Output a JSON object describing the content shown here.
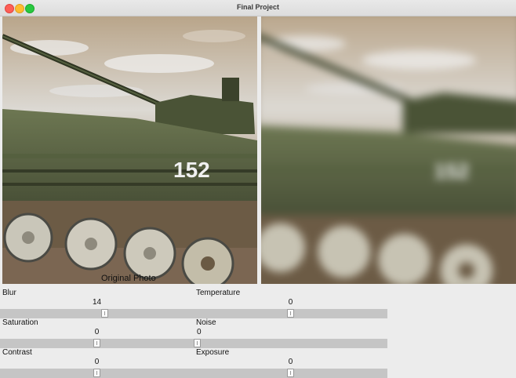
{
  "window": {
    "title": "Final Project"
  },
  "preview": {
    "original_caption": "Original Photo",
    "hull_number": "152"
  },
  "controls": [
    {
      "id": "blur",
      "label": "Blur",
      "value": "14",
      "level": 0.54
    },
    {
      "id": "temperature",
      "label": "Temperature",
      "value": "0",
      "level": 0.5
    },
    {
      "id": "saturation",
      "label": "Saturation",
      "value": "0",
      "level": 0.5
    },
    {
      "id": "noise",
      "label": "Noise",
      "value": "0",
      "level": 0.0
    },
    {
      "id": "contrast",
      "label": "Contrast",
      "value": "0",
      "level": 0.5
    },
    {
      "id": "exposure",
      "label": "Exposure",
      "value": "0",
      "level": 0.5
    }
  ]
}
